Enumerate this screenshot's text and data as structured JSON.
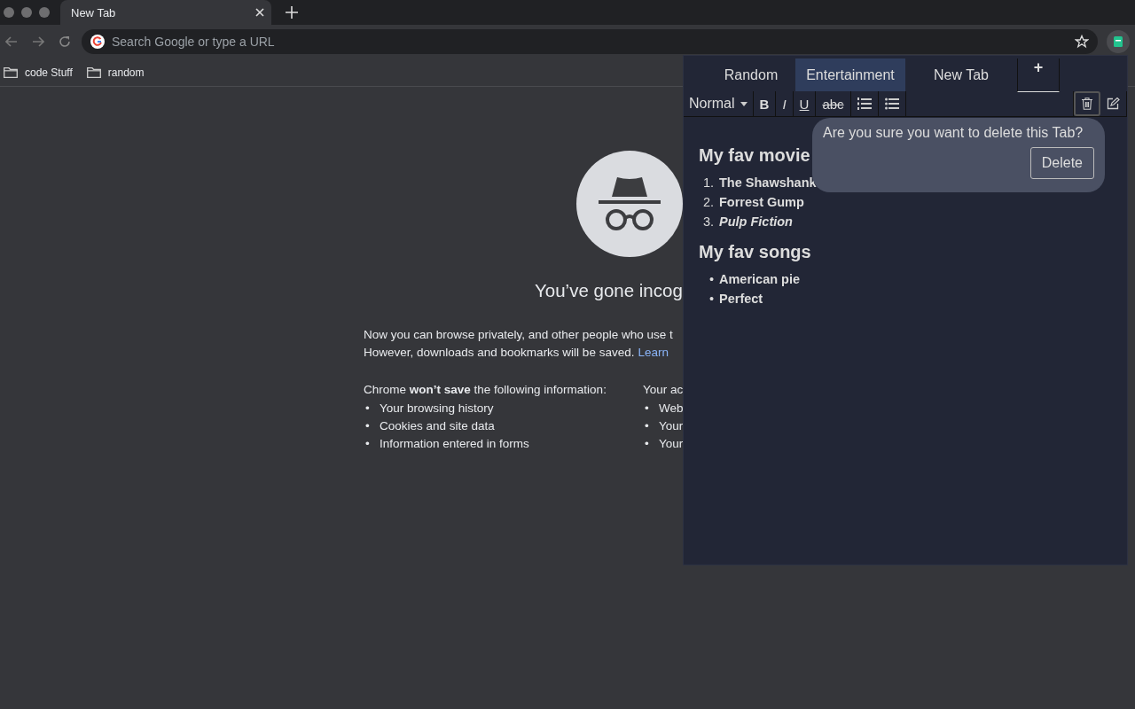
{
  "browser": {
    "tabs": [
      {
        "title": "New Tab",
        "selected": true
      }
    ],
    "address": {
      "placeholder": "Search Google or type a URL"
    },
    "bookmarks": [
      {
        "label": "code Stuff"
      },
      {
        "label": "random"
      }
    ]
  },
  "page": {
    "heading": "You’ve gone incog",
    "intro": "Now you can browse privately, and other people who use t",
    "intro2": "However, downloads and bookmarks will be saved.",
    "link": "Learn",
    "columns": [
      {
        "heading": "Chrome **won’t save** the following information:",
        "items": [
          {
            "marker": "•",
            "text": "Your browsing history"
          },
          {
            "marker": "•",
            "text": "Cookies and site data"
          },
          {
            "marker": "•",
            "text": "Information entered in forms"
          }
        ]
      },
      {
        "heading": "Your ac",
        "items": [
          {
            "marker": "•",
            "text": "Web"
          },
          {
            "marker": "•",
            "text": "Your"
          },
          {
            "marker": "•",
            "text": "Your"
          }
        ]
      }
    ]
  },
  "extension": {
    "tabs": [
      {
        "label": "Random",
        "selected": false
      },
      {
        "label": "Entertainment",
        "selected": true
      },
      {
        "label": "New Tab",
        "selected": false
      }
    ],
    "add_tab": "+",
    "toolbar": {
      "format": "Normal",
      "bold": "B",
      "italic": "I",
      "underline": "U",
      "strike": "abc"
    },
    "content": [
      {
        "kind": "heading",
        "text": "My fav movie"
      },
      {
        "kind": "list",
        "items": [
          {
            "marker": "1.",
            "text": "The Shawshank",
            "italic": false
          },
          {
            "marker": "2.",
            "text": "Forrest Gump",
            "italic": false
          },
          {
            "marker": "3.",
            "text": "Pulp Fiction",
            "italic": true
          }
        ]
      },
      {
        "kind": "heading",
        "text": "My fav songs"
      },
      {
        "kind": "list",
        "items": [
          {
            "marker": "•",
            "text": "American pie",
            "italic": false
          },
          {
            "marker": "•",
            "text": "Perfect",
            "italic": false
          }
        ]
      }
    ],
    "confirm": {
      "message": "Are you sure you want to delete this Tab?",
      "button": "Delete"
    }
  }
}
